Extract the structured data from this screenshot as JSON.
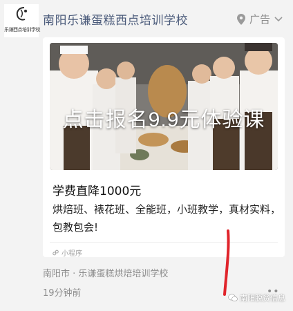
{
  "header": {
    "logo_caption": "乐谦西点培训学校",
    "account_name": "南阳乐谦蛋糕西点培训学校",
    "ad_label": "广告"
  },
  "ad_card": {
    "image_overlay_text": "点击报名9.9元体验课",
    "headline": "学费直降1000元",
    "description": "烘焙班、裱花班、全能班，小班教学，真材实料，包教包会!",
    "mini_program_label": "小程序"
  },
  "footer": {
    "location": "南阳市 · 乐谦蛋糕烘焙培训学校",
    "time_ago": "19分钟前"
  },
  "watermark": {
    "text": "南阳脱贫信息"
  },
  "colors": {
    "account_name": "#4a5a7a",
    "annotation_stroke": "#e0242b"
  }
}
